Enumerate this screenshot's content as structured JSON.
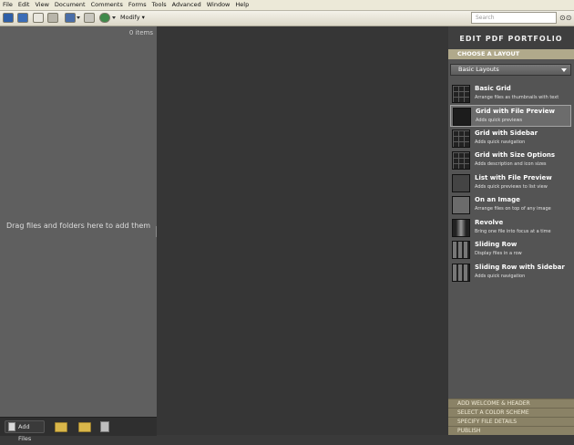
{
  "menu": [
    "File",
    "Edit",
    "View",
    "Document",
    "Comments",
    "Forms",
    "Tools",
    "Advanced",
    "Window",
    "Help"
  ],
  "toolbar": {
    "modify_label": "Modify"
  },
  "search": {
    "placeholder": "Search"
  },
  "left": {
    "items_count": "0 items",
    "drag_hint": "Drag files and folders here to add them"
  },
  "bottom": {
    "add_files_label": "Add Files"
  },
  "panel": {
    "title": "EDIT PDF PORTFOLIO",
    "choose_layout": "CHOOSE A LAYOUT",
    "dropdown_value": "Basic Layouts",
    "layouts": [
      {
        "title": "Basic Grid",
        "desc": "Arrange files as thumbnails with text"
      },
      {
        "title": "Grid with File Preview",
        "desc": "Adds quick previews"
      },
      {
        "title": "Grid with Sidebar",
        "desc": "Adds quick navigation"
      },
      {
        "title": "Grid with Size Options",
        "desc": "Adds description and icon sizes"
      },
      {
        "title": "List with File Preview",
        "desc": "Adds quick previews to list view"
      },
      {
        "title": "On an Image",
        "desc": "Arrange files on top of any image"
      },
      {
        "title": "Revolve",
        "desc": "Bring one file into focus at a time"
      },
      {
        "title": "Sliding Row",
        "desc": "Display files in a row"
      },
      {
        "title": "Sliding Row with Sidebar",
        "desc": "Adds quick navigation"
      }
    ],
    "footer": [
      "ADD WELCOME & HEADER",
      "SELECT A COLOR SCHEME",
      "SPECIFY FILE DETAILS",
      "PUBLISH"
    ]
  }
}
